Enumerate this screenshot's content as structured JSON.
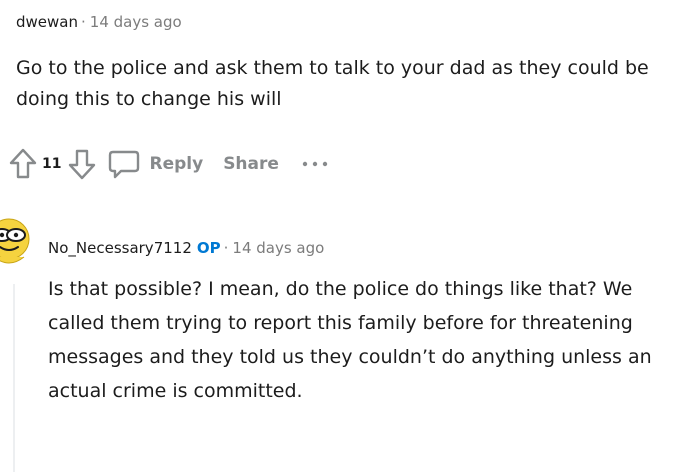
{
  "parent_comment": {
    "author": "dwewan",
    "separator": "·",
    "time": "14 days ago",
    "body": "Go to the police and ask them to talk to your dad as they could be doing this to change his will",
    "vote_count": "11",
    "reply_label": "Reply",
    "share_label": "Share",
    "more_label": "···",
    "icons": {
      "upvote": "upvote-arrow-icon",
      "downvote": "downvote-arrow-icon",
      "reply": "speech-bubble-icon",
      "more": "more-dots-icon"
    }
  },
  "reply_comment": {
    "author": "No_Necessary7112",
    "op_badge": "OP",
    "separator": "·",
    "time": "14 days ago",
    "body": "Is that possible? I mean, do the police do things like that? We called them trying to report this family before for threatening messages and they told us they couldn’t do anything unless an actual crime is committed.",
    "avatar": "snoo-avatar-icon"
  },
  "colors": {
    "text": "#1c1c1c",
    "meta_gray": "#7c7c7c",
    "action_gray": "#878a8c",
    "op_blue": "#0079d3",
    "thread_line": "#edeff1",
    "avatar_yellow": "#f5d33f"
  }
}
